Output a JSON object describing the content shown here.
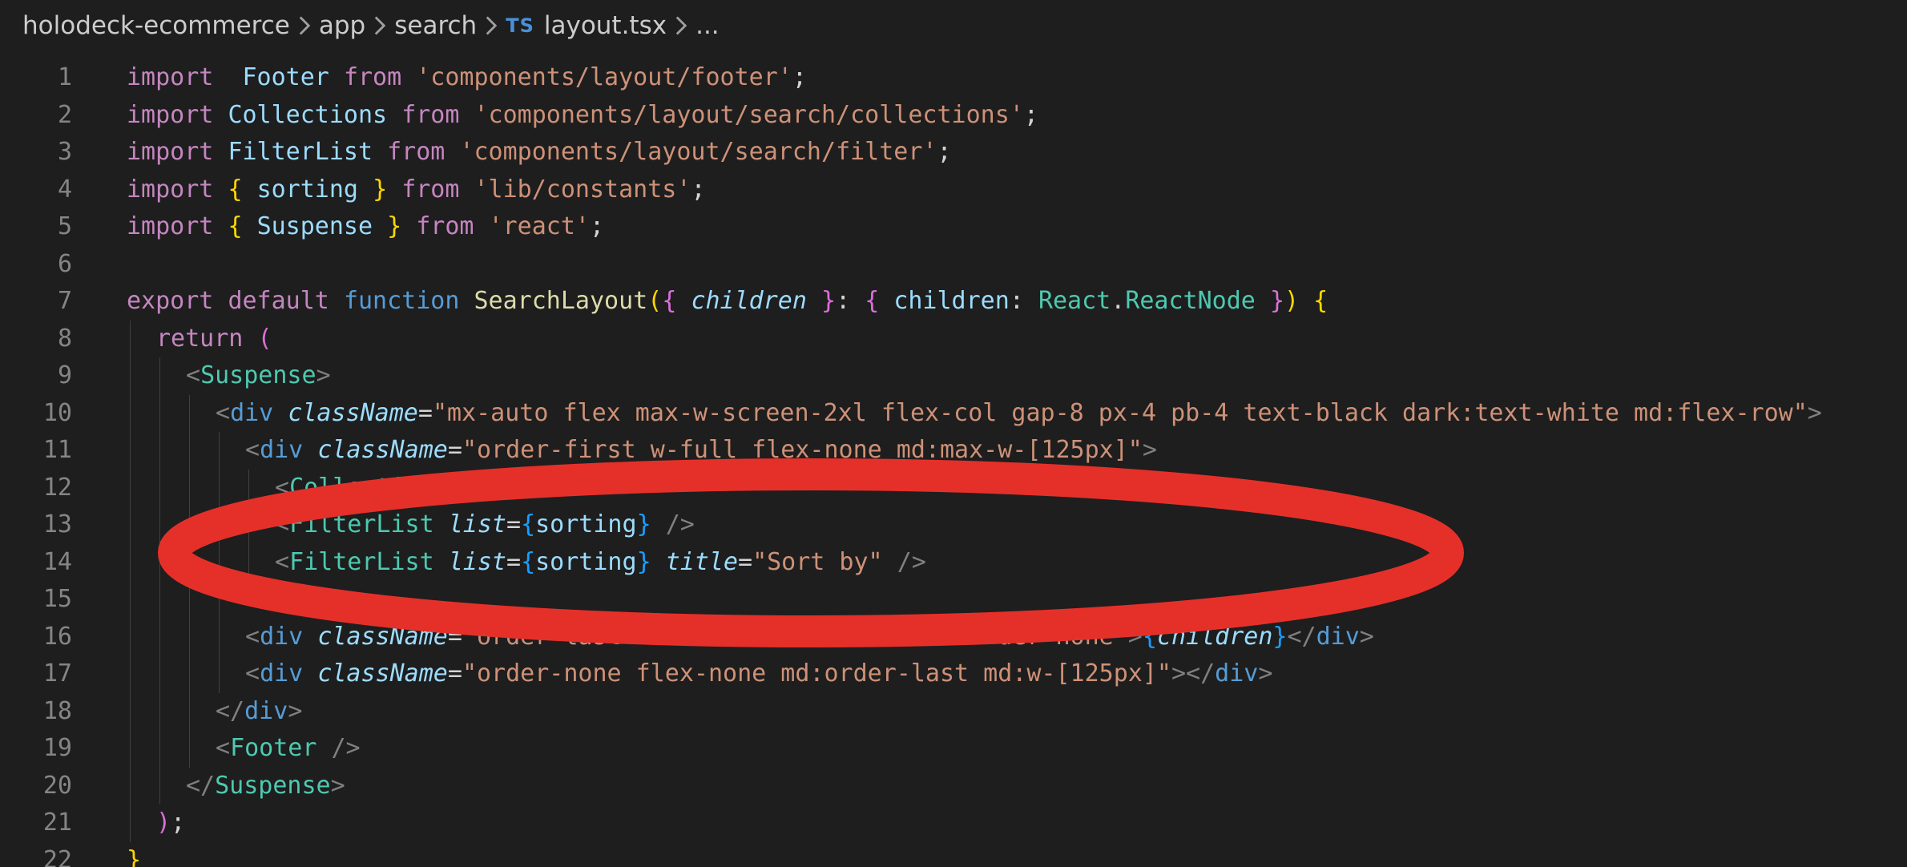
{
  "breadcrumb": {
    "items": [
      "holodeck-ecommerce",
      "app",
      "search",
      "layout.tsx",
      "..."
    ],
    "file_icon": "TS"
  },
  "editor": {
    "lines": [
      {
        "n": "1",
        "tokens": [
          [
            "kw",
            "import"
          ],
          [
            "",
            "  "
          ],
          [
            "id",
            "Footer"
          ],
          [
            "",
            " "
          ],
          [
            "kw",
            "from"
          ],
          [
            "",
            " "
          ],
          [
            "str",
            "'components/layout/footer'"
          ],
          [
            "",
            ";"
          ]
        ]
      },
      {
        "n": "2",
        "tokens": [
          [
            "kw",
            "import"
          ],
          [
            "",
            " "
          ],
          [
            "id",
            "Collections"
          ],
          [
            "",
            " "
          ],
          [
            "kw",
            "from"
          ],
          [
            "",
            " "
          ],
          [
            "str",
            "'components/layout/search/collections'"
          ],
          [
            "",
            ";"
          ]
        ]
      },
      {
        "n": "3",
        "tokens": [
          [
            "kw",
            "import"
          ],
          [
            "",
            " "
          ],
          [
            "id",
            "FilterList"
          ],
          [
            "",
            " "
          ],
          [
            "kw",
            "from"
          ],
          [
            "",
            " "
          ],
          [
            "str",
            "'components/layout/search/filter'"
          ],
          [
            "",
            ";"
          ]
        ]
      },
      {
        "n": "4",
        "tokens": [
          [
            "kw",
            "import"
          ],
          [
            "",
            " "
          ],
          [
            "bracket1",
            "{"
          ],
          [
            "",
            " "
          ],
          [
            "id",
            "sorting"
          ],
          [
            "",
            " "
          ],
          [
            "bracket1",
            "}"
          ],
          [
            "",
            " "
          ],
          [
            "kw",
            "from"
          ],
          [
            "",
            " "
          ],
          [
            "str",
            "'lib/constants'"
          ],
          [
            "",
            ";"
          ]
        ]
      },
      {
        "n": "5",
        "tokens": [
          [
            "kw",
            "import"
          ],
          [
            "",
            " "
          ],
          [
            "bracket1",
            "{"
          ],
          [
            "",
            " "
          ],
          [
            "id",
            "Suspense"
          ],
          [
            "",
            " "
          ],
          [
            "bracket1",
            "}"
          ],
          [
            "",
            " "
          ],
          [
            "kw",
            "from"
          ],
          [
            "",
            " "
          ],
          [
            "str",
            "'react'"
          ],
          [
            "",
            ";"
          ]
        ]
      },
      {
        "n": "6",
        "tokens": []
      },
      {
        "n": "7",
        "tokens": [
          [
            "kw",
            "export"
          ],
          [
            "",
            " "
          ],
          [
            "kw",
            "default"
          ],
          [
            "",
            " "
          ],
          [
            "kwb",
            "function"
          ],
          [
            "",
            " "
          ],
          [
            "fn",
            "SearchLayout"
          ],
          [
            "bracket1",
            "("
          ],
          [
            "bracket2",
            "{"
          ],
          [
            "",
            " "
          ],
          [
            "param",
            "children"
          ],
          [
            "",
            " "
          ],
          [
            "bracket2",
            "}"
          ],
          [
            "",
            ": "
          ],
          [
            "bracket2",
            "{"
          ],
          [
            "",
            " "
          ],
          [
            "id",
            "children"
          ],
          [
            "",
            ": "
          ],
          [
            "ty",
            "React"
          ],
          [
            "",
            "."
          ],
          [
            "ty",
            "ReactNode"
          ],
          [
            "",
            " "
          ],
          [
            "bracket2",
            "}"
          ],
          [
            "bracket1",
            ")"
          ],
          [
            "",
            " "
          ],
          [
            "bracket1",
            "{"
          ]
        ]
      },
      {
        "n": "8",
        "tokens": [
          [
            "",
            ""
          ],
          [
            "kw",
            "return"
          ],
          [
            "",
            " "
          ],
          [
            "bracket2",
            "("
          ]
        ]
      },
      {
        "n": "9",
        "tokens": [
          [
            "punc",
            "<"
          ],
          [
            "ty",
            "Suspense"
          ],
          [
            "punc",
            ">"
          ]
        ]
      },
      {
        "n": "10",
        "tokens": [
          [
            "punc",
            "<"
          ],
          [
            "tag",
            "div"
          ],
          [
            "",
            " "
          ],
          [
            "attr",
            "className"
          ],
          [
            "",
            "="
          ],
          [
            "str",
            "\"mx-auto flex max-w-screen-2xl flex-col gap-8 px-4 pb-4 text-black dark:text-white md:flex-row\""
          ],
          [
            "punc",
            ">"
          ]
        ]
      },
      {
        "n": "11",
        "tokens": [
          [
            "punc",
            "<"
          ],
          [
            "tag",
            "div"
          ],
          [
            "",
            " "
          ],
          [
            "attr",
            "className"
          ],
          [
            "",
            "="
          ],
          [
            "str",
            "\"order-first w-full flex-none md:max-w-[125px]\""
          ],
          [
            "punc",
            ">"
          ]
        ]
      },
      {
        "n": "12",
        "tokens": [
          [
            "punc",
            "<"
          ],
          [
            "ty",
            "Collections"
          ],
          [
            "",
            " "
          ],
          [
            "punc",
            "/>"
          ]
        ]
      },
      {
        "n": "13",
        "tokens": [
          [
            "punc",
            "<"
          ],
          [
            "ty",
            "FilterList"
          ],
          [
            "",
            " "
          ],
          [
            "attr",
            "list"
          ],
          [
            "",
            "="
          ],
          [
            "bracket3",
            "{"
          ],
          [
            "id",
            "sorting"
          ],
          [
            "bracket3",
            "}"
          ],
          [
            "",
            " "
          ],
          [
            "punc",
            "/>"
          ]
        ]
      },
      {
        "n": "14",
        "tokens": [
          [
            "punc",
            "<"
          ],
          [
            "ty",
            "FilterList"
          ],
          [
            "",
            " "
          ],
          [
            "attr",
            "list"
          ],
          [
            "",
            "="
          ],
          [
            "bracket3",
            "{"
          ],
          [
            "id",
            "sorting"
          ],
          [
            "bracket3",
            "}"
          ],
          [
            "",
            " "
          ],
          [
            "attr",
            "title"
          ],
          [
            "",
            "="
          ],
          [
            "str",
            "\"Sort by\""
          ],
          [
            "",
            " "
          ],
          [
            "punc",
            "/>"
          ]
        ]
      },
      {
        "n": "15",
        "tokens": [
          [
            "punc",
            "</"
          ],
          [
            "tag",
            "div"
          ],
          [
            "punc",
            ">"
          ]
        ]
      },
      {
        "n": "16",
        "tokens": [
          [
            "punc",
            "<"
          ],
          [
            "tag",
            "div"
          ],
          [
            "",
            " "
          ],
          [
            "attr",
            "className"
          ],
          [
            "",
            "="
          ],
          [
            "str",
            "\"order-last min-h-screen w-full md:order-none\""
          ],
          [
            "punc",
            ">"
          ],
          [
            "bracket3",
            "{"
          ],
          [
            "param",
            "children"
          ],
          [
            "bracket3",
            "}"
          ],
          [
            "punc",
            "</"
          ],
          [
            "tag",
            "div"
          ],
          [
            "punc",
            ">"
          ]
        ]
      },
      {
        "n": "17",
        "tokens": [
          [
            "punc",
            "<"
          ],
          [
            "tag",
            "div"
          ],
          [
            "",
            " "
          ],
          [
            "attr",
            "className"
          ],
          [
            "",
            "="
          ],
          [
            "str",
            "\"order-none flex-none md:order-last md:w-[125px]\""
          ],
          [
            "punc",
            "></"
          ],
          [
            "tag",
            "div"
          ],
          [
            "punc",
            ">"
          ]
        ]
      },
      {
        "n": "18",
        "tokens": [
          [
            "punc",
            "</"
          ],
          [
            "tag",
            "div"
          ],
          [
            "punc",
            ">"
          ]
        ]
      },
      {
        "n": "19",
        "tokens": [
          [
            "punc",
            "<"
          ],
          [
            "ty",
            "Footer"
          ],
          [
            "",
            " "
          ],
          [
            "punc",
            "/>"
          ]
        ]
      },
      {
        "n": "20",
        "tokens": [
          [
            "punc",
            "</"
          ],
          [
            "ty",
            "Suspense"
          ],
          [
            "punc",
            ">"
          ]
        ]
      },
      {
        "n": "21",
        "tokens": [
          [
            "bracket2",
            ")"
          ],
          [
            "",
            ";"
          ]
        ]
      },
      {
        "n": "22",
        "tokens": [
          [
            "bracket1",
            "}"
          ]
        ]
      }
    ]
  },
  "annotation": {
    "color": "#e5302a",
    "description": "red ellipse circling line 14"
  }
}
